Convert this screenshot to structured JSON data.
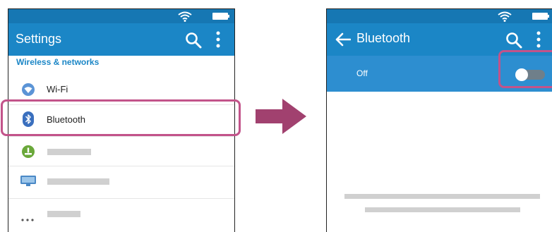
{
  "settings_screen": {
    "title": "Settings",
    "section_header": "Wireless & networks",
    "items": [
      {
        "label": "Wi-Fi",
        "icon": "wifi-circle-icon"
      },
      {
        "label": "Bluetooth",
        "icon": "bluetooth-icon"
      },
      {
        "label": "",
        "icon": "battery-data-icon"
      },
      {
        "label": "",
        "icon": "display-icon"
      },
      {
        "label": "",
        "icon": "more-dots-icon"
      }
    ]
  },
  "bluetooth_screen": {
    "title": "Bluetooth",
    "toggle_label": "Off",
    "toggle_on": false
  },
  "colors": {
    "appbar": "#1b86c6",
    "statusbar": "#1677b3",
    "toggle_row": "#2d8ed0",
    "highlight": "#c2538a",
    "arrow": "#a1416f"
  }
}
